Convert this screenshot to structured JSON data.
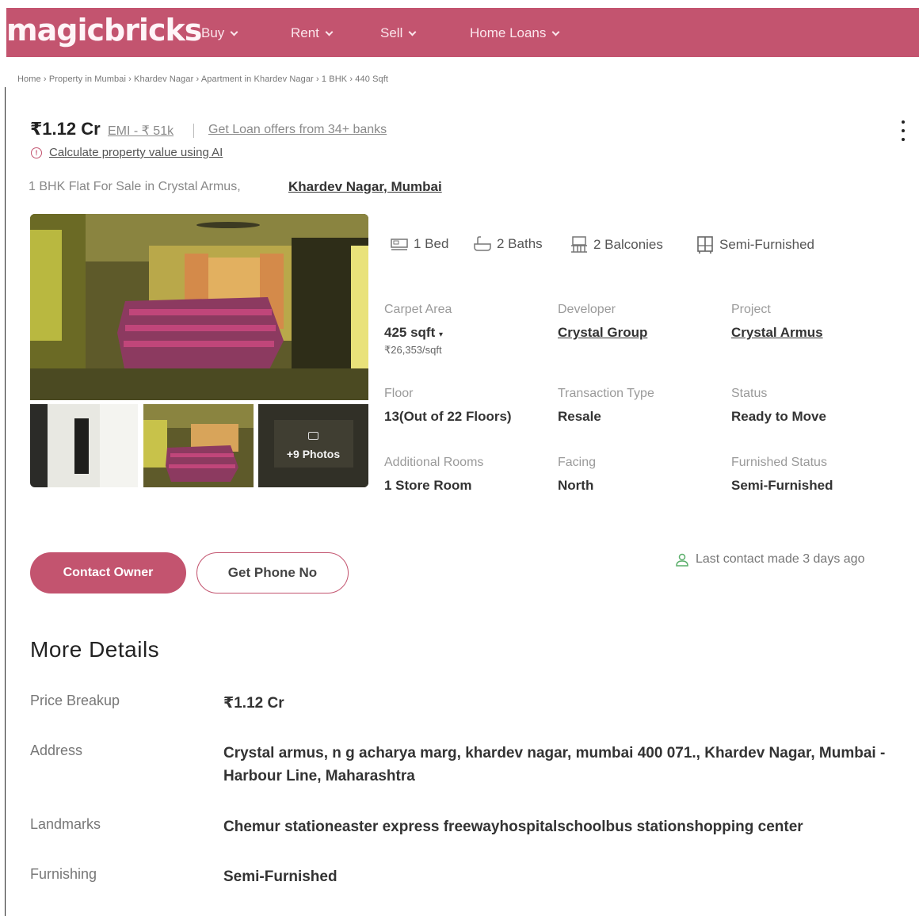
{
  "header": {
    "logo": "magicbricks",
    "nav": [
      {
        "label": "Buy"
      },
      {
        "label": "Rent"
      },
      {
        "label": "Sell"
      },
      {
        "label": "Home Loans"
      }
    ]
  },
  "breadcrumb": "Home › Property in Mumbai › Khardev Nagar › Apartment in Khardev Nagar › 1 BHK › 440 Sqft",
  "listing": {
    "price": "₹1.12 Cr",
    "emi": "EMI - ₹ 51k",
    "loan_offer": "Get Loan offers from 34+ banks",
    "calculate": "Calculate property value using AI",
    "subtitle": "1 BHK Flat For Sale in Crystal Armus,",
    "location": "Khardev Nagar, Mumbai"
  },
  "photos": {
    "more_label": "+9 Photos"
  },
  "amenities": {
    "bed": "1 Bed",
    "baths": "2 Baths",
    "balconies": "2 Balconies",
    "furnishing": "Semi-Furnished"
  },
  "details": {
    "carpet_area_label": "Carpet Area",
    "carpet_area_value": "425 sqft",
    "carpet_area_rate": "₹26,353/sqft",
    "developer_label": "Developer",
    "developer_value": "Crystal Group",
    "project_label": "Project",
    "project_value": "Crystal Armus",
    "floor_label": "Floor",
    "floor_value": "13(Out of 22 Floors)",
    "transaction_label": "Transaction Type",
    "transaction_value": "Resale",
    "status_label": "Status",
    "status_value": "Ready to Move",
    "additional_label": "Additional Rooms",
    "additional_value": "1 Store Room",
    "facing_label": "Facing",
    "facing_value": "North",
    "furnished_label": "Furnished Status",
    "furnished_value": "Semi-Furnished"
  },
  "actions": {
    "contact_owner": "Contact Owner",
    "get_phone": "Get Phone No",
    "last_contact": "Last contact made 3 days ago"
  },
  "more_details": {
    "title": "More Details",
    "rows": [
      {
        "label": "Price Breakup",
        "value": "₹1.12 Cr"
      },
      {
        "label": "Address",
        "value": "Crystal armus, n g acharya marg, khardev nagar, mumbai 400 071., Khardev Nagar, Mumbai - Harbour Line, Maharashtra"
      },
      {
        "label": "Landmarks",
        "value": "Chemur stationeaster express freewayhospitalschoolbus stationshopping center"
      },
      {
        "label": "Furnishing",
        "value": "Semi-Furnished"
      }
    ]
  },
  "colors": {
    "brand": "#c3546f"
  }
}
